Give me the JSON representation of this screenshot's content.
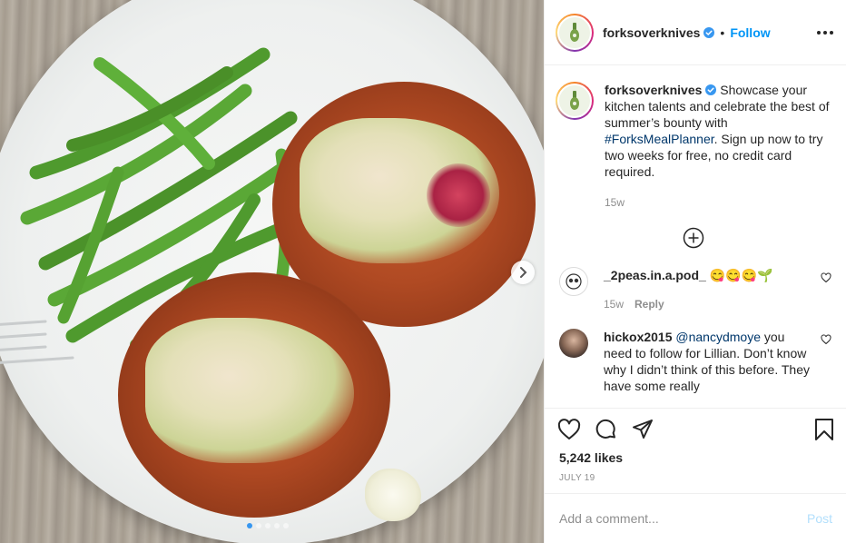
{
  "post": {
    "author": "forksoverknives",
    "follow_label": "Follow",
    "separator": "•",
    "image_alt": "Pulled jackfruit sandwiches with slaw and green beans on a white plate",
    "carousel": {
      "count": 5,
      "active_index": 0
    }
  },
  "caption": {
    "username": "forksoverknives",
    "text_before": "Showcase your kitchen talents and celebrate the best of summer’s bounty with ",
    "hashtag": "#ForksMealPlanner",
    "text_after": ". Sign up now to try two weeks for free, no credit card required.",
    "time": "15w"
  },
  "comments": [
    {
      "username": "_2peas.in.a.pod_",
      "text": "😋😋😋🌱",
      "time": "15w",
      "reply_label": "Reply"
    },
    {
      "username": "hickox2015",
      "mention": "@nancydmoye",
      "text": " you need to follow for Lillian. Don’t know why I didn’t think of this before. They have some really"
    }
  ],
  "likes": "5,242 likes",
  "date": "JULY 19",
  "add_comment": {
    "placeholder": "Add a comment...",
    "post_label": "Post"
  },
  "colors": {
    "accent": "#0095f6",
    "link": "#00376b",
    "muted": "#8e8e8e"
  },
  "icons": [
    "plus-circle-icon",
    "heart-icon",
    "comment-icon",
    "share-icon",
    "bookmark-icon",
    "more-options-icon",
    "verified-badge-icon",
    "chevron-right-icon"
  ]
}
